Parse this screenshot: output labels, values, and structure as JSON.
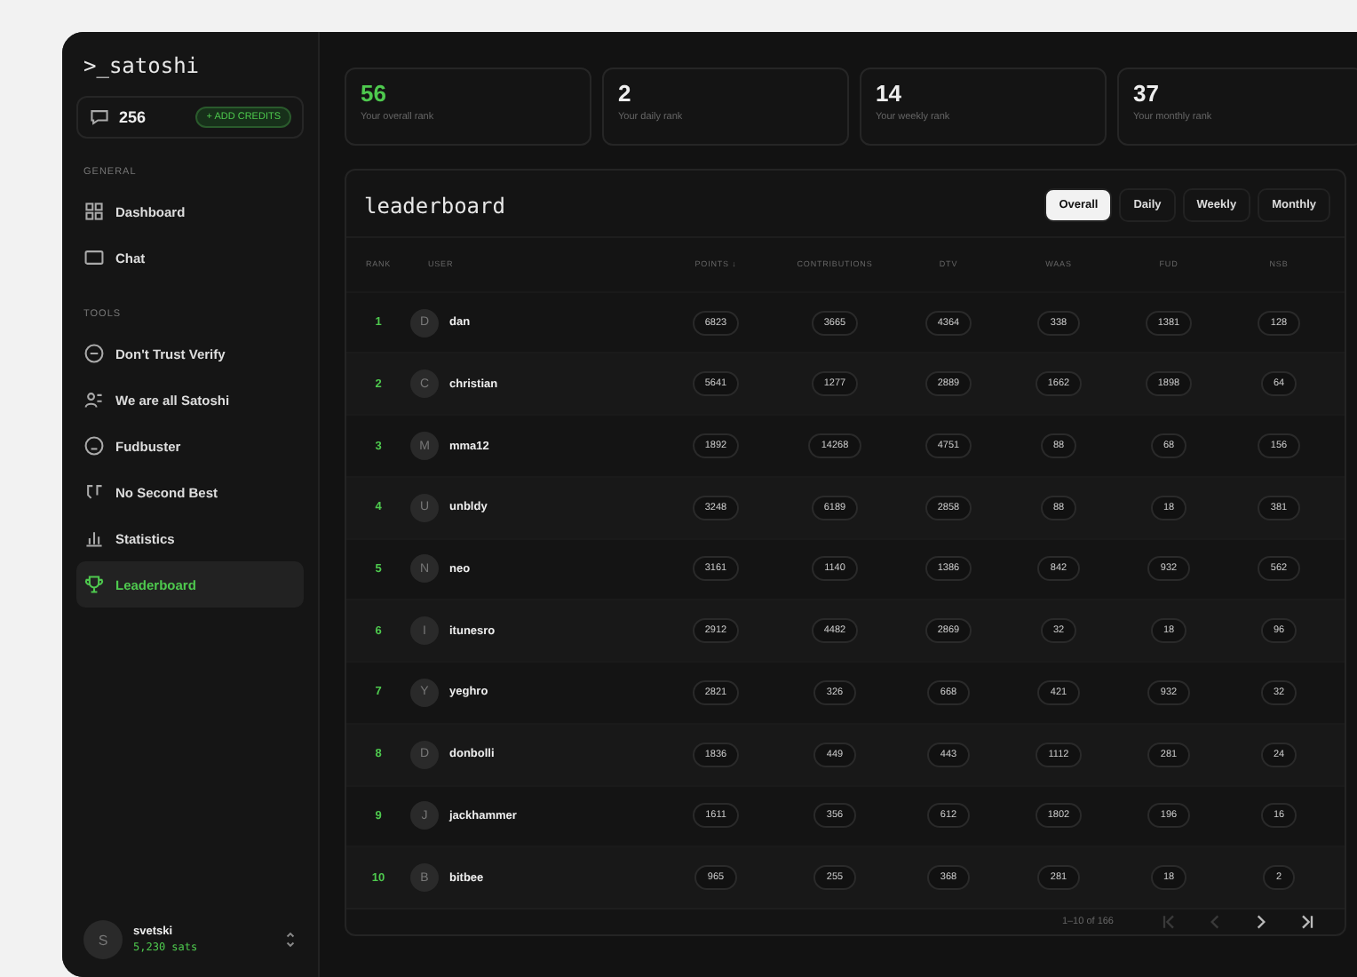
{
  "sidebar": {
    "logo": ">_satoshi",
    "credits": {
      "count": "256",
      "button": "+ ADD CREDITS"
    },
    "sections": [
      {
        "title": "GENERAL",
        "items": [
          {
            "label": "Dashboard",
            "selected": false
          },
          {
            "label": "Chat",
            "selected": false
          }
        ]
      },
      {
        "title": "TOOLS",
        "items": [
          {
            "label": "Don't Trust Verify",
            "selected": false
          },
          {
            "label": "We are all Satoshi",
            "selected": false
          },
          {
            "label": "Fudbuster",
            "selected": false
          },
          {
            "label": "No Second Best",
            "selected": false
          },
          {
            "label": "Statistics",
            "selected": false
          },
          {
            "label": "Leaderboard",
            "selected": true
          }
        ]
      }
    ],
    "user": {
      "initial": "S",
      "name": "svetski",
      "balance": "5,230 sats"
    }
  },
  "stats": [
    {
      "value": "56",
      "label": "Your overall rank",
      "highlight": true
    },
    {
      "value": "2",
      "label": "Your daily rank",
      "highlight": false
    },
    {
      "value": "14",
      "label": "Your weekly rank",
      "highlight": false
    },
    {
      "value": "37",
      "label": "Your monthly rank",
      "highlight": false
    }
  ],
  "leaderboard": {
    "title": "leaderboard",
    "tabs": [
      {
        "label": "Overall",
        "selected": true
      },
      {
        "label": "Daily",
        "selected": false
      },
      {
        "label": "Weekly",
        "selected": false
      },
      {
        "label": "Monthly",
        "selected": false
      }
    ],
    "columns": [
      "RANK",
      "USER",
      "POINTS ↓",
      "CONTRIBUTIONS",
      "DTV",
      "WAAS",
      "FUD",
      "NSB"
    ],
    "rows": [
      {
        "rank": "1",
        "initial": "D",
        "user": "dan",
        "values": [
          "6823",
          "3665",
          "4364",
          "338",
          "1381",
          "128"
        ]
      },
      {
        "rank": "2",
        "initial": "C",
        "user": "christian",
        "values": [
          "5641",
          "1277",
          "2889",
          "1662",
          "1898",
          "64"
        ]
      },
      {
        "rank": "3",
        "initial": "M",
        "user": "mma12",
        "values": [
          "1892",
          "14268",
          "4751",
          "88",
          "68",
          "156"
        ]
      },
      {
        "rank": "4",
        "initial": "U",
        "user": "unbldy",
        "values": [
          "3248",
          "6189",
          "2858",
          "88",
          "18",
          "381"
        ]
      },
      {
        "rank": "5",
        "initial": "N",
        "user": "neo",
        "values": [
          "3161",
          "1140",
          "1386",
          "842",
          "932",
          "562"
        ]
      },
      {
        "rank": "6",
        "initial": "I",
        "user": "itunesro",
        "values": [
          "2912",
          "4482",
          "2869",
          "32",
          "18",
          "96"
        ]
      },
      {
        "rank": "7",
        "initial": "Y",
        "user": "yeghro",
        "values": [
          "2821",
          "326",
          "668",
          "421",
          "932",
          "32"
        ]
      },
      {
        "rank": "8",
        "initial": "D",
        "user": "donbolli",
        "values": [
          "1836",
          "449",
          "443",
          "1112",
          "281",
          "24"
        ]
      },
      {
        "rank": "9",
        "initial": "J",
        "user": "jackhammer",
        "values": [
          "1611",
          "356",
          "612",
          "1802",
          "196",
          "16"
        ]
      },
      {
        "rank": "10",
        "initial": "B",
        "user": "bitbee",
        "values": [
          "965",
          "255",
          "368",
          "281",
          "18",
          "2"
        ]
      }
    ],
    "pagination": {
      "range": "1–10 of 166",
      "buttons": [
        {
          "disabled": true
        },
        {
          "disabled": true
        },
        {
          "disabled": false
        },
        {
          "disabled": false
        }
      ]
    }
  }
}
